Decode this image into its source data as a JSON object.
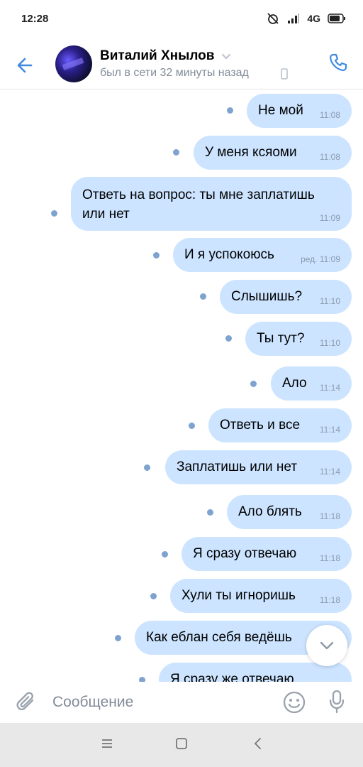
{
  "status_bar": {
    "time": "12:28",
    "network": "4G"
  },
  "header": {
    "contact_name": "Виталий Хнылов",
    "last_seen": "был в сети 32 минуты назад"
  },
  "messages": [
    {
      "text": "Не мой",
      "time": "11:08"
    },
    {
      "text": "У меня ксяоми",
      "time": "11:08"
    },
    {
      "text": "Ответь на вопрос: ты мне заплатишь или нет",
      "time": "11:09"
    },
    {
      "text": "И я успокоюсь",
      "time": "ред. 11:09"
    },
    {
      "text": "Слышишь?",
      "time": "11:10"
    },
    {
      "text": "Ты тут?",
      "time": "11:10"
    },
    {
      "text": "Ало",
      "time": "11:14"
    },
    {
      "text": "Ответь и все",
      "time": "11:14"
    },
    {
      "text": "Заплатишь или нет",
      "time": "11:14"
    },
    {
      "text": "Ало блять",
      "time": "11:18"
    },
    {
      "text": "Я сразу отвечаю",
      "time": "11:18"
    },
    {
      "text": "Хули ты игноришь",
      "time": "11:18"
    },
    {
      "text": "Как еблан себя ведёшь",
      "time": ""
    },
    {
      "text": "Я сразу же отвечаю",
      "time": ""
    }
  ],
  "composer": {
    "placeholder": "Сообщение"
  },
  "colors": {
    "accent": "#3f8ae0",
    "bubble": "#cce4ff",
    "unread_dot": "#7fa3cf"
  },
  "icons": [
    "back-arrow-icon",
    "chevron-down-icon",
    "phone-icon",
    "mobile-icon",
    "paperclip-icon",
    "emoji-icon",
    "microphone-icon",
    "chevron-down-icon",
    "menu-icon",
    "home-square-icon",
    "back-triangle-icon"
  ]
}
